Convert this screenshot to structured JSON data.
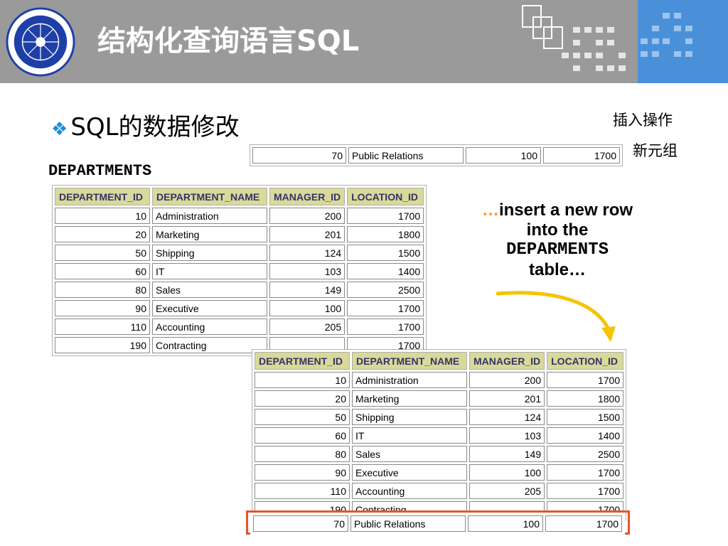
{
  "header": {
    "title": "结构化查询语言SQL"
  },
  "section": {
    "bullet": "❖",
    "heading": "SQL的数据修改"
  },
  "annotations": {
    "insert_op": "插入操作",
    "new_tuple": "新元组"
  },
  "table_label": "DEPARTMENTS",
  "callout": {
    "ellipsis": "…",
    "line1": "insert a new row",
    "line2": "into the",
    "line3": "DEPARMENTS",
    "line4": "table…"
  },
  "columns": [
    "DEPARTMENT_ID",
    "DEPARTMENT_NAME",
    "MANAGER_ID",
    "LOCATION_ID"
  ],
  "rows": [
    [
      "10",
      "Administration",
      "200",
      "1700"
    ],
    [
      "20",
      "Marketing",
      "201",
      "1800"
    ],
    [
      "50",
      "Shipping",
      "124",
      "1500"
    ],
    [
      "60",
      "IT",
      "103",
      "1400"
    ],
    [
      "80",
      "Sales",
      "149",
      "2500"
    ],
    [
      "90",
      "Executive",
      "100",
      "1700"
    ],
    [
      "110",
      "Accounting",
      "205",
      "1700"
    ],
    [
      "190",
      "Contracting",
      "",
      "1700"
    ]
  ],
  "new_row": [
    "70",
    "Public Relations",
    "100",
    "1700"
  ],
  "colors": {
    "header_bg": "#9a9a9a",
    "header_accent": "#4a90d9",
    "table_header_bg": "#d9d99a",
    "highlight_border": "#e8532a",
    "arrow": "#f5c400",
    "bullet": "#1a8fd8"
  }
}
